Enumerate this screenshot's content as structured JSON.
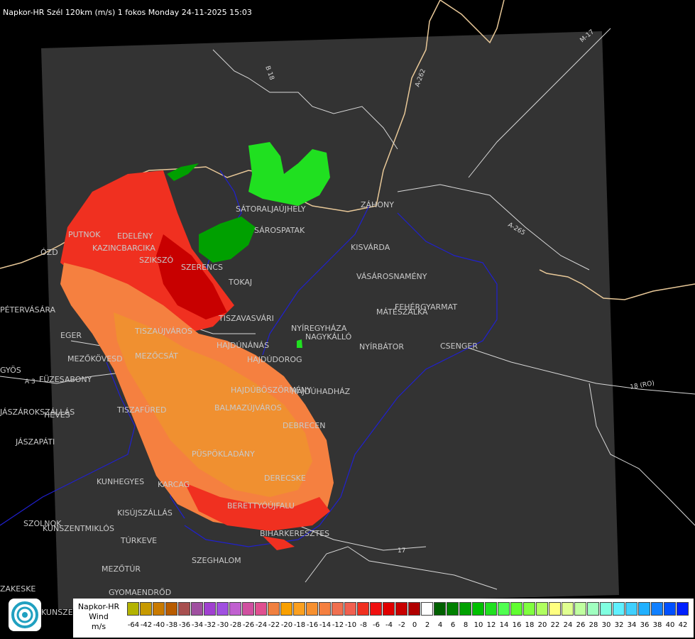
{
  "header": {
    "title": "Napkor-HR Szél 120km (m/s) 1 fokos Monday 24-11-2025 15:03"
  },
  "legend": {
    "title_lines": [
      "Napkor-HR",
      "Wind",
      "m/s"
    ],
    "values": [
      -64,
      -42,
      -40,
      -38,
      -36,
      -34,
      -32,
      -30,
      -28,
      -26,
      -24,
      -22,
      -20,
      -18,
      -16,
      -14,
      -12,
      -10,
      -8,
      -6,
      -4,
      -2,
      0,
      2,
      4,
      6,
      8,
      10,
      12,
      14,
      16,
      18,
      20,
      22,
      24,
      26,
      28,
      30,
      32,
      34,
      36,
      38,
      40,
      42
    ],
    "colors": [
      "#b3b300",
      "#c79a00",
      "#c97a00",
      "#b85c00",
      "#a85050",
      "#a050a0",
      "#a040d0",
      "#a050e0",
      "#c060d0",
      "#d050a0",
      "#e05090",
      "#f08040",
      "#f9a000",
      "#fba020",
      "#f7902f",
      "#f58040",
      "#f07050",
      "#f06050",
      "#f03020",
      "#f01010",
      "#e00000",
      "#c80000",
      "#b00000",
      "#ffffff",
      "#006000",
      "#008000",
      "#00a000",
      "#00c000",
      "#20e020",
      "#50ff50",
      "#60ff30",
      "#80ff40",
      "#b0ff60",
      "#ffff80",
      "#e0ff90",
      "#c0ffa0",
      "#a0ffc0",
      "#80ffe0",
      "#60f0ff",
      "#40d0ff",
      "#20b0ff",
      "#1080ff",
      "#0050ff",
      "#0020ff"
    ]
  },
  "map": {
    "cities": [
      {
        "name": "SÁTORALJAÚJHELY"
      },
      {
        "name": "SÁROSPATAK"
      },
      {
        "name": "ZÁHONY"
      },
      {
        "name": "PUTNOK"
      },
      {
        "name": "EDELÉNY"
      },
      {
        "name": "KAZINCBARCIKA"
      },
      {
        "name": "SZIKSZÓ"
      },
      {
        "name": "SZERENCS"
      },
      {
        "name": "TOKAJ"
      },
      {
        "name": "KISVÁRDA"
      },
      {
        "name": "VÁSÁROSNAMÉNY"
      },
      {
        "name": "MÁTÉSZALKA"
      },
      {
        "name": "FEHÉRGYARMAT"
      },
      {
        "name": "NYÍREGYHÁZA"
      },
      {
        "name": "NAGYKÁLLÓ"
      },
      {
        "name": "NYÍRBÁTOR"
      },
      {
        "name": "CSENGER"
      },
      {
        "name": "TISZAVASVÁRI"
      },
      {
        "name": "EGER"
      },
      {
        "name": "MEZŐKÖVESD"
      },
      {
        "name": "MEZŐCSÁT"
      },
      {
        "name": "TISZAÚJVÁROS"
      },
      {
        "name": "HAJDÚNÁNÁS"
      },
      {
        "name": "HAJDÚDOROG"
      },
      {
        "name": "HAJDÚBÖSZÖRMÉNY"
      },
      {
        "name": "HAJDÚHADHÁZ"
      },
      {
        "name": "BALMAZÚJVÁROS"
      },
      {
        "name": "DEBRECEN"
      },
      {
        "name": "FÜZESABONY"
      },
      {
        "name": "HEVES"
      },
      {
        "name": "TISZAFÜRED"
      },
      {
        "name": "JÁSZAPÁTI"
      },
      {
        "name": "KUNHEGYES"
      },
      {
        "name": "KARCAG"
      },
      {
        "name": "PÜSPÖKLADÁNY"
      },
      {
        "name": "DERECSKE"
      },
      {
        "name": "BERETTYÓÚJFALU"
      },
      {
        "name": "KISÚJSZÁLLÁS"
      },
      {
        "name": "TÚRKEVE"
      },
      {
        "name": "BIHARKERESZTES"
      },
      {
        "name": "SZEGHALOM"
      },
      {
        "name": "MEZŐTÚR"
      },
      {
        "name": "GYOMAENDRŐD"
      },
      {
        "name": "SZOLNOK"
      },
      {
        "name": "KUNSZENTMIKLÓS"
      },
      {
        "name": "PÉTERVÁSÁRA"
      },
      {
        "name": "GYÖS"
      },
      {
        "name": "ÓZD"
      },
      {
        "name": "JÁSZÁROKSZÁLLÁS"
      },
      {
        "name": "KUNSZENTMÁRTON"
      },
      {
        "name": "ZAKESKE"
      }
    ],
    "roads": [
      {
        "label": "B 18"
      },
      {
        "label": "A-262"
      },
      {
        "label": "M-17"
      },
      {
        "label": "A-265"
      },
      {
        "label": "18 (RO)"
      },
      {
        "label": "A 3"
      },
      {
        "label": "17"
      }
    ]
  }
}
